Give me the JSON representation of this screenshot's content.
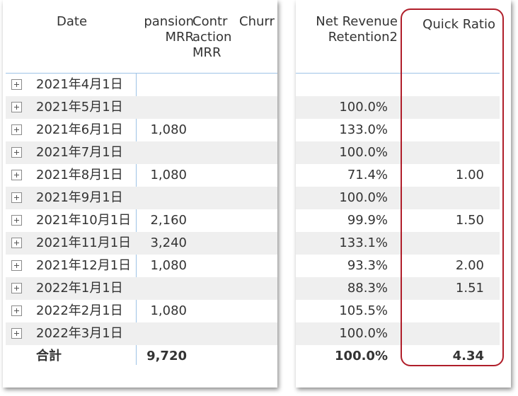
{
  "headers": {
    "date": "Date",
    "expansion_line1": "pansion",
    "expansion_line2": "MRR",
    "contraction_line1": "Contr",
    "contraction_line2": "action",
    "contraction_line3": "MRR",
    "churn": "Churr",
    "nrr_line1": "Net Revenue",
    "nrr_line2": "Retention2",
    "quick_ratio": "Quick Ratio"
  },
  "rows": [
    {
      "date": "2021年4月1日",
      "expansion": "",
      "nrr": "",
      "quick_ratio": ""
    },
    {
      "date": "2021年5月1日",
      "expansion": "",
      "nrr": "100.0%",
      "quick_ratio": ""
    },
    {
      "date": "2021年6月1日",
      "expansion": "1,080",
      "nrr": "133.0%",
      "quick_ratio": ""
    },
    {
      "date": "2021年7月1日",
      "expansion": "",
      "nrr": "100.0%",
      "quick_ratio": ""
    },
    {
      "date": "2021年8月1日",
      "expansion": "1,080",
      "nrr": "71.4%",
      "quick_ratio": "1.00"
    },
    {
      "date": "2021年9月1日",
      "expansion": "",
      "nrr": "100.0%",
      "quick_ratio": ""
    },
    {
      "date": "2021年10月1日",
      "expansion": "2,160",
      "nrr": "99.9%",
      "quick_ratio": "1.50"
    },
    {
      "date": "2021年11月1日",
      "expansion": "3,240",
      "nrr": "133.1%",
      "quick_ratio": ""
    },
    {
      "date": "2021年12月1日",
      "expansion": "1,080",
      "nrr": "93.3%",
      "quick_ratio": "2.00"
    },
    {
      "date": "2022年1月1日",
      "expansion": "",
      "nrr": "88.3%",
      "quick_ratio": "1.51"
    },
    {
      "date": "2022年2月1日",
      "expansion": "1,080",
      "nrr": "105.5%",
      "quick_ratio": ""
    },
    {
      "date": "2022年3月1日",
      "expansion": "",
      "nrr": "100.0%",
      "quick_ratio": ""
    }
  ],
  "total": {
    "label": "合計",
    "expansion": "9,720",
    "nrr": "100.0%",
    "quick_ratio": "4.34"
  },
  "colors": {
    "highlight_border": "#b01e2a",
    "grid_line": "#9ec3e6",
    "alt_row": "#efefef"
  }
}
